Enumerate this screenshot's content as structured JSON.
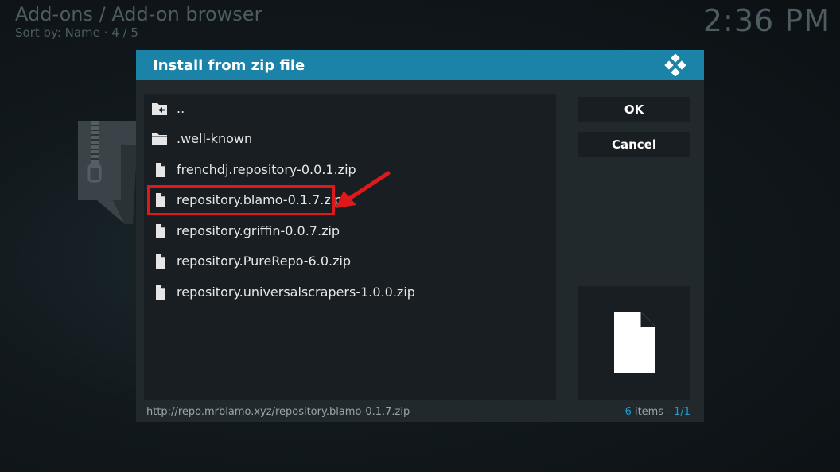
{
  "header": {
    "breadcrumb": "Add-ons / Add-on browser",
    "sort_info": "Sort by: Name  ·  4 / 5",
    "clock": "2:36 PM"
  },
  "dialog": {
    "title": "Install from zip file",
    "items": [
      {
        "label": "..",
        "icon": "folder-back-icon"
      },
      {
        "label": ".well-known",
        "icon": "folder-icon"
      },
      {
        "label": "frenchdj.repository-0.0.1.zip",
        "icon": "file-icon"
      },
      {
        "label": "repository.blamo-0.1.7.zip",
        "icon": "file-icon"
      },
      {
        "label": "repository.griffin-0.0.7.zip",
        "icon": "file-icon"
      },
      {
        "label": "repository.PureRepo-6.0.zip",
        "icon": "file-icon"
      },
      {
        "label": "repository.universalscrapers-1.0.0.zip",
        "icon": "file-icon"
      }
    ],
    "ok_label": "OK",
    "cancel_label": "Cancel",
    "footer_path": "http://repo.mrblamo.xyz/repository.blamo-0.1.7.zip",
    "count_number": "6",
    "count_text": " items - ",
    "page": "1/1"
  },
  "colors": {
    "header_bar": "#1b83a8",
    "highlight": "#e0181b",
    "accent": "#1b9dd6"
  }
}
